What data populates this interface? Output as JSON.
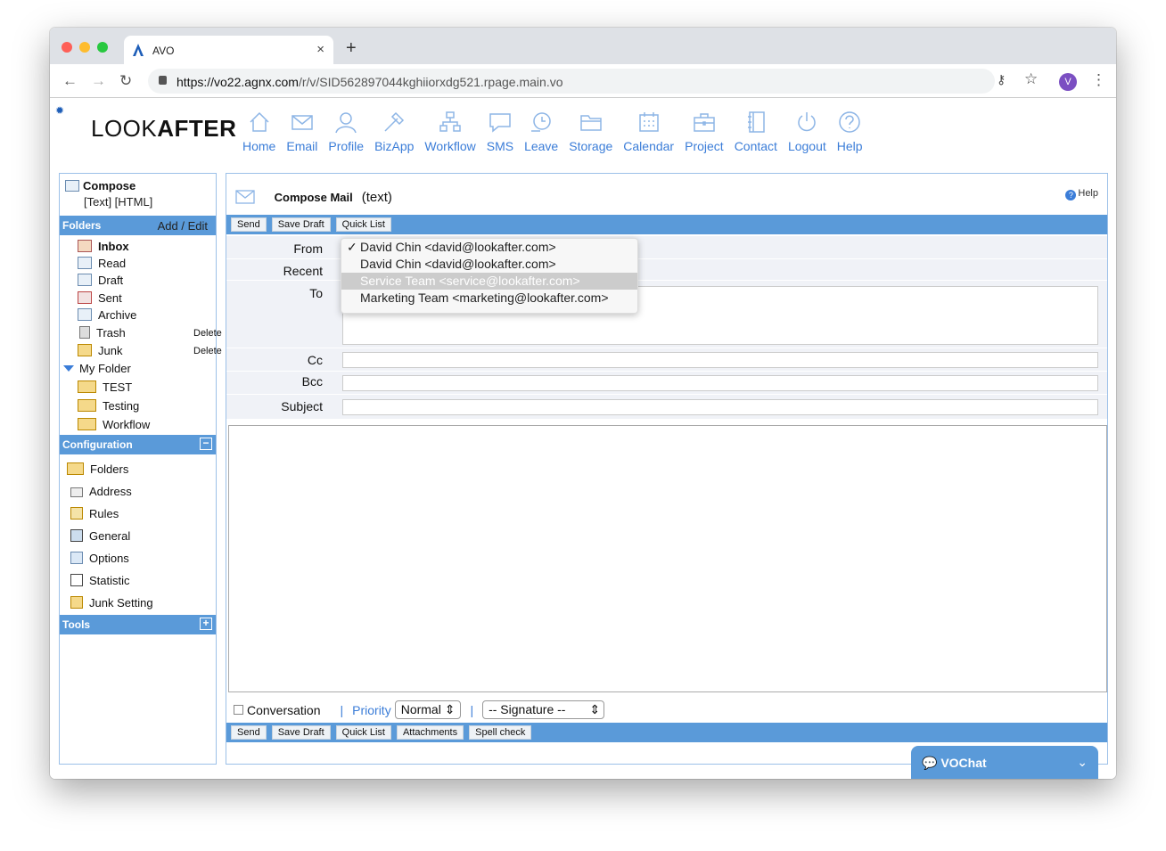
{
  "browser": {
    "tab_title": "AVO",
    "url_host": "https://vo22.agnx.com",
    "url_path": "/r/v/SID562897044kghiiorxdg521.rpage.main.vo",
    "avatar_letter": "V"
  },
  "brand": {
    "light": "LOOK",
    "bold": "AFTER"
  },
  "nav": [
    "Home",
    "Email",
    "Profile",
    "BizApp",
    "Workflow",
    "SMS",
    "Leave",
    "Storage",
    "Calendar",
    "Project",
    "Contact",
    "Logout",
    "Help"
  ],
  "sidebar": {
    "compose": "Compose",
    "compose_types": "[Text] [HTML]",
    "folders_header": "Folders",
    "folders_action": "Add / Edit",
    "folders": [
      "Inbox",
      "Read",
      "Draft",
      "Sent",
      "Archive",
      "Trash",
      "Junk"
    ],
    "delete_label": "Delete",
    "my_folder": "My Folder",
    "my_folders": [
      "TEST",
      "Testing",
      "Workflow"
    ],
    "config_header": "Configuration",
    "config_items": [
      "Folders",
      "Address",
      "Rules",
      "General",
      "Options",
      "Statistic",
      "Junk Setting"
    ],
    "tools_header": "Tools"
  },
  "compose": {
    "title": "Compose Mail",
    "mode": "(text)",
    "help": "Help",
    "top_buttons": [
      "Send",
      "Save Draft",
      "Quick List"
    ],
    "labels": {
      "from": "From",
      "recent": "Recent",
      "to": "To",
      "cc": "Cc",
      "bcc": "Bcc",
      "subject": "Subject"
    },
    "from_options": [
      "David Chin <david@lookafter.com>",
      "David Chin <david@lookafter.com>",
      "Service Team <service@lookafter.com>",
      "Marketing Team <marketing@lookafter.com>"
    ],
    "conversation": "Conversation",
    "sep": "|",
    "priority_label": "Priority",
    "priority_value": "Normal",
    "signature_value": "-- Signature --",
    "bottom_buttons": [
      "Send",
      "Save Draft",
      "Quick List",
      "Attachments",
      "Spell check"
    ]
  },
  "chat": {
    "label": "VOChat"
  }
}
